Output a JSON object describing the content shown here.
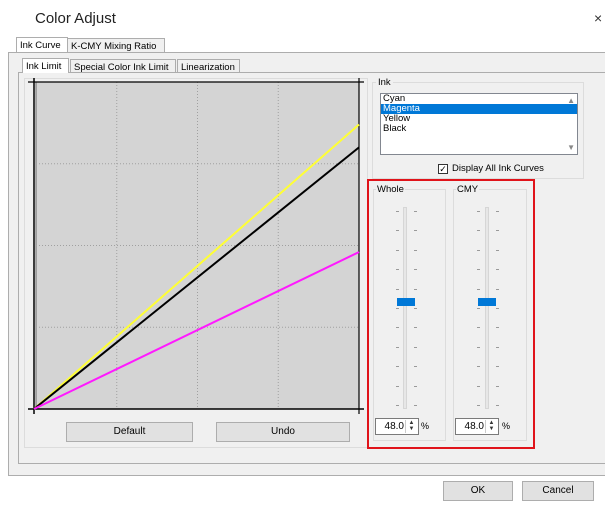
{
  "window": {
    "title": "Color Adjust",
    "close_glyph": "×"
  },
  "tabs": [
    {
      "label": "Ink Curve",
      "active": true
    },
    {
      "label": "K-CMY Mixing Ratio",
      "active": false
    }
  ],
  "subtabs": [
    {
      "label": "Ink Limit",
      "active": true
    },
    {
      "label": "Special Color Ink Limit",
      "active": false
    },
    {
      "label": "Linearization",
      "active": false
    }
  ],
  "graph": {
    "x_range": [
      0,
      100
    ],
    "y_range": [
      0,
      100
    ],
    "curves": [
      {
        "ink": "Yellow",
        "color": "#ffff33",
        "end_value": 87
      },
      {
        "ink": "Black",
        "color": "#000000",
        "end_value": 80
      },
      {
        "ink": "Magenta",
        "color": "#ff19ff",
        "end_value": 48
      }
    ],
    "default_button": "Default",
    "undo_button": "Undo"
  },
  "ink": {
    "group_label": "Ink",
    "options": [
      "Cyan",
      "Magenta",
      "Yellow",
      "Black"
    ],
    "selected": "Magenta",
    "display_all_label": "Display All Ink Curves",
    "display_all_checked": true
  },
  "sliders": {
    "whole": {
      "label": "Whole",
      "value": "48.0",
      "unit": "%",
      "level": 0.48
    },
    "cmy": {
      "label": "CMY",
      "value": "48.0",
      "unit": "%",
      "level": 0.48
    }
  },
  "highlight_color": "#e0131a",
  "footer": {
    "ok": "OK",
    "cancel": "Cancel"
  }
}
